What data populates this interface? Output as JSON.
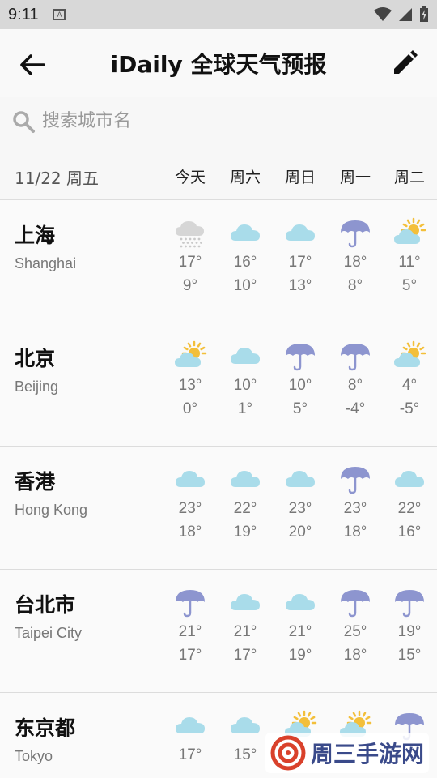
{
  "status_bar": {
    "time": "9:11",
    "notification_glyph": "A"
  },
  "header": {
    "title": "iDaily 全球天气预报",
    "back_icon": "arrow-left-icon",
    "edit_icon": "pencil-icon"
  },
  "search": {
    "placeholder": "搜索城市名",
    "value": ""
  },
  "date_header": {
    "date": "11/22 周五",
    "days": [
      "今天",
      "周六",
      "周日",
      "周一",
      "周二"
    ]
  },
  "cities": [
    {
      "name_cn": "上海",
      "name_en": "Shanghai",
      "forecast": [
        {
          "icon": "snow",
          "high": "17°",
          "low": "9°"
        },
        {
          "icon": "cloud",
          "high": "16°",
          "low": "10°"
        },
        {
          "icon": "cloud",
          "high": "17°",
          "low": "13°"
        },
        {
          "icon": "umbrella",
          "high": "18°",
          "low": "8°"
        },
        {
          "icon": "sun-cloud",
          "high": "11°",
          "low": "5°"
        }
      ]
    },
    {
      "name_cn": "北京",
      "name_en": "Beijing",
      "forecast": [
        {
          "icon": "sun-cloud",
          "high": "13°",
          "low": "0°"
        },
        {
          "icon": "cloud",
          "high": "10°",
          "low": "1°"
        },
        {
          "icon": "umbrella",
          "high": "10°",
          "low": "5°"
        },
        {
          "icon": "umbrella",
          "high": "8°",
          "low": "-4°"
        },
        {
          "icon": "sun-cloud",
          "high": "4°",
          "low": "-5°"
        }
      ]
    },
    {
      "name_cn": "香港",
      "name_en": "Hong Kong",
      "forecast": [
        {
          "icon": "cloud",
          "high": "23°",
          "low": "18°"
        },
        {
          "icon": "cloud",
          "high": "22°",
          "low": "19°"
        },
        {
          "icon": "cloud",
          "high": "23°",
          "low": "20°"
        },
        {
          "icon": "umbrella",
          "high": "23°",
          "low": "18°"
        },
        {
          "icon": "cloud",
          "high": "22°",
          "low": "16°"
        }
      ]
    },
    {
      "name_cn": "台北市",
      "name_en": "Taipei City",
      "forecast": [
        {
          "icon": "umbrella",
          "high": "21°",
          "low": "17°"
        },
        {
          "icon": "cloud",
          "high": "21°",
          "low": "17°"
        },
        {
          "icon": "cloud",
          "high": "21°",
          "low": "19°"
        },
        {
          "icon": "umbrella",
          "high": "25°",
          "low": "18°"
        },
        {
          "icon": "umbrella",
          "high": "19°",
          "low": "15°"
        }
      ]
    },
    {
      "name_cn": "东京都",
      "name_en": "Tokyo",
      "forecast": [
        {
          "icon": "cloud",
          "high": "17°",
          "low": ""
        },
        {
          "icon": "cloud",
          "high": "15°",
          "low": ""
        },
        {
          "icon": "sun-cloud",
          "high": "",
          "low": ""
        },
        {
          "icon": "sun-cloud",
          "high": "",
          "low": ""
        },
        {
          "icon": "umbrella",
          "high": "",
          "low": ""
        }
      ]
    }
  ],
  "watermark": {
    "text": "周三手游网"
  },
  "colors": {
    "cloud": "#a9dcea",
    "umbrella": "#8d95cf",
    "sun": "#f3bf3a",
    "snow_cloud": "#d6d6d6"
  }
}
